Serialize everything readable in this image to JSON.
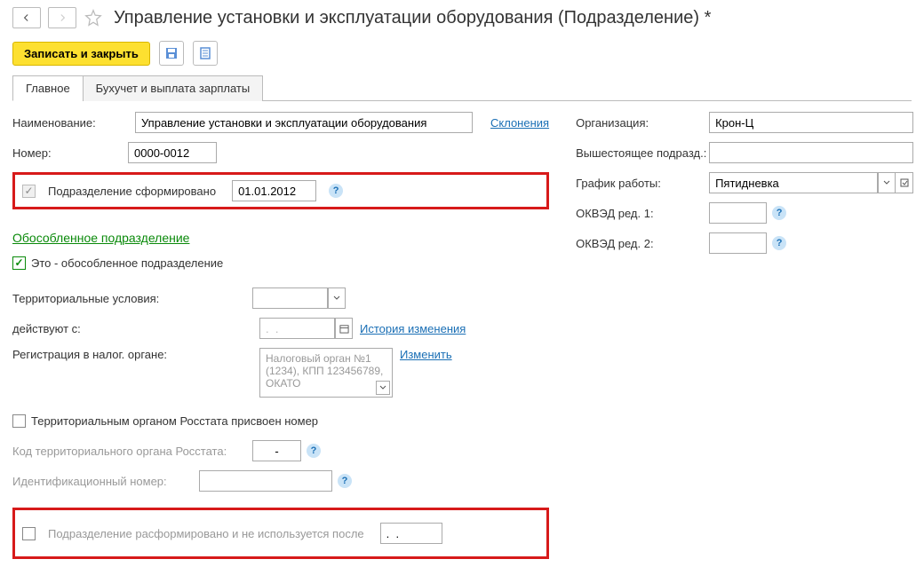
{
  "header": {
    "title": "Управление установки и эксплуатации оборудования (Подразделение) *"
  },
  "toolbar": {
    "save_close": "Записать и закрыть"
  },
  "tabs": {
    "main": "Главное",
    "accounting": "Бухучет и выплата зарплаты"
  },
  "left": {
    "name_label": "Наименование:",
    "name_value": "Управление установки и эксплуатации оборудования",
    "declensions": "Склонения",
    "number_label": "Номер:",
    "number_value": "0000-0012",
    "formed_label": "Подразделение сформировано",
    "formed_date": "01.01.2012",
    "section": "Обособленное подразделение",
    "is_separate": "Это - обособленное подразделение",
    "territory_label": "Территориальные условия:",
    "valid_from_label": "действуют с:",
    "valid_from_value": ".  .",
    "history_link": "История изменения",
    "tax_label": "Регистрация в налог. органе:",
    "tax_value": "Налоговый орган №1 (1234), КПП 123456789, ОКАТО",
    "change_link": "Изменить",
    "stat_assigned": "Территориальным органом Росстата присвоен номер",
    "stat_code_label": "Код территориального органа Росстата:",
    "stat_code_value": "-",
    "ident_label": "Идентификационный номер:",
    "disbanded_label": "Подразделение расформировано и не используется после",
    "disbanded_value": ".  ."
  },
  "right": {
    "org_label": "Организация:",
    "org_value": "Крон-Ц",
    "parent_label": "Вышестоящее подразд.:",
    "schedule_label": "График работы:",
    "schedule_value": "Пятидневка",
    "okved1_label": "ОКВЭД ред. 1:",
    "okved2_label": "ОКВЭД ред. 2:"
  }
}
